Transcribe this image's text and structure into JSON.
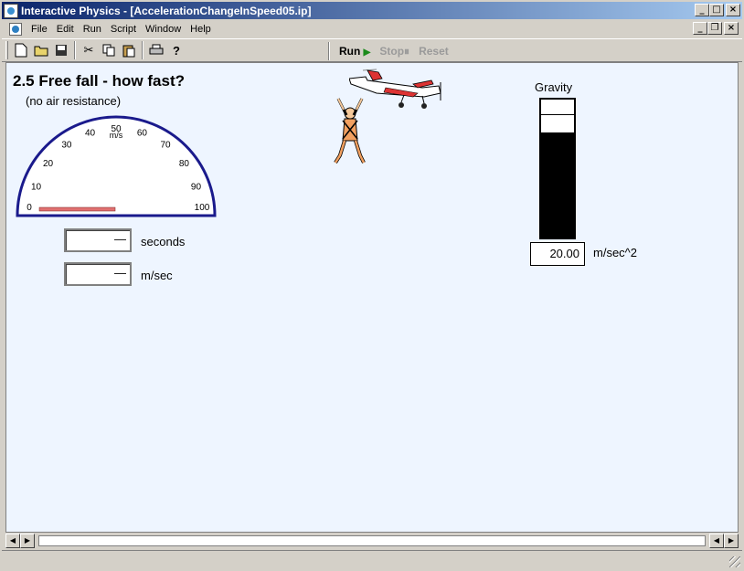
{
  "window": {
    "title": "Interactive Physics - [AccelerationChangeInSpeed05.ip]"
  },
  "menu": [
    "File",
    "Edit",
    "Run",
    "Script",
    "Window",
    "Help"
  ],
  "toolbar": {
    "run": "Run",
    "stop": "Stop",
    "reset": "Reset"
  },
  "scene": {
    "title": "2.5 Free fall - how fast?",
    "subtitle": "(no air resistance)"
  },
  "speedometer": {
    "unit": "m/s",
    "ticks": [
      "0",
      "10",
      "20",
      "30",
      "40",
      "50",
      "60",
      "70",
      "80",
      "90",
      "100"
    ],
    "value": 0
  },
  "meters": [
    {
      "value": "—",
      "label": "seconds"
    },
    {
      "value": "—",
      "label": "m/sec"
    }
  ],
  "gravity": {
    "label": "Gravity",
    "value": "20.00",
    "unit": "m/sec^2"
  },
  "colors": {
    "needle": "#e07070",
    "gauge_arc": "#1a1a8c",
    "canvas": "#eef5ff"
  }
}
